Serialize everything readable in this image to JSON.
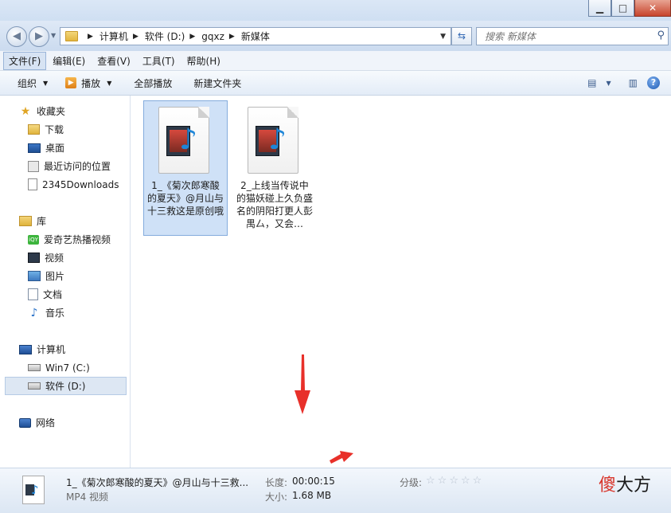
{
  "window": {
    "minimize": "▁",
    "maximize": "□",
    "close": "✕"
  },
  "address": {
    "crumbs": [
      "计算机",
      "软件 (D:)",
      "gqxz",
      "新媒体"
    ]
  },
  "search": {
    "placeholder": "搜索 新媒体"
  },
  "menu": [
    "文件(F)",
    "编辑(E)",
    "查看(V)",
    "工具(T)",
    "帮助(H)"
  ],
  "toolbar": {
    "organize": "组织",
    "play": "播放",
    "play_all": "全部播放",
    "new_folder": "新建文件夹"
  },
  "sidebar": {
    "favorites": {
      "title": "收藏夹",
      "items": [
        "下载",
        "桌面",
        "最近访问的位置",
        "2345Downloads"
      ]
    },
    "libraries": {
      "title": "库",
      "items": [
        "爱奇艺热播视频",
        "视频",
        "图片",
        "文档",
        "音乐"
      ]
    },
    "computer": {
      "title": "计算机",
      "items": [
        "Win7 (C:)",
        "软件 (D:)"
      ]
    },
    "network": {
      "title": "网络"
    }
  },
  "files": [
    {
      "caption": "1_《菊次郎寒酸的夏天》@月山与十三救这是原创哦",
      "selected": true
    },
    {
      "caption": "2_上线当传说中的猫妖碰上久负盛名的阴阳打更人彭禺厶，又会…",
      "selected": false
    }
  ],
  "details": {
    "name": "1_《菊次郎寒酸的夏天》@月山与十三救...",
    "type": "MP4 视频",
    "length_label": "长度:",
    "length_value": "00:00:15",
    "size_label": "大小:",
    "size_value": "1.68 MB",
    "rating_label": "分级:",
    "rating_stars": 0
  },
  "watermark": {
    "c1": "傻",
    "rest": "大方"
  },
  "colors": {
    "accent": "#d8342a",
    "selection": "#cfe1f7"
  }
}
